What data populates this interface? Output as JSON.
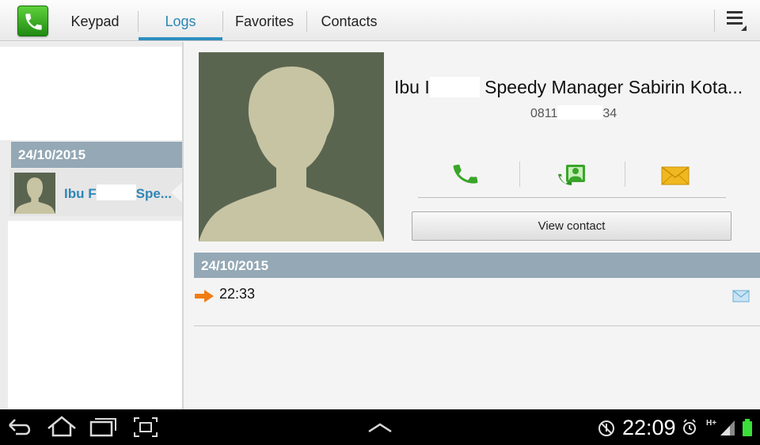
{
  "tabs": [
    {
      "label": "Keypad",
      "active": false
    },
    {
      "label": "Logs",
      "active": true
    },
    {
      "label": "Favorites",
      "active": false
    },
    {
      "label": "Contacts",
      "active": false
    }
  ],
  "icons": {
    "app": "phone-app-icon",
    "menu": "overflow-menu-icon",
    "call": "phone-call-icon",
    "video_call": "video-call-icon",
    "message": "envelope-icon",
    "outgoing": "outgoing-arrow-icon",
    "log_message": "envelope-icon"
  },
  "log_list": {
    "date_header": "24/10/2015",
    "item": {
      "name_prefix": "Ibu F",
      "name_suffix": "Spe..."
    }
  },
  "contact": {
    "name_prefix": "Ibu I",
    "name_suffix": "Speedy Manager Sabirin Kota...",
    "number_prefix": "0811",
    "number_suffix": "34",
    "view_contact_label": "View contact"
  },
  "history": {
    "date_header": "24/10/2015",
    "entries": [
      {
        "time": "22:33",
        "direction": "outgoing"
      }
    ]
  },
  "status_bar": {
    "time": "22:09",
    "network": "H+"
  },
  "colors": {
    "accent": "#2f8fc0",
    "date_header_bg": "#94a8b5",
    "call_green": "#3aa52a",
    "message_yellow": "#f0b820",
    "outgoing_orange": "#f07d14"
  }
}
